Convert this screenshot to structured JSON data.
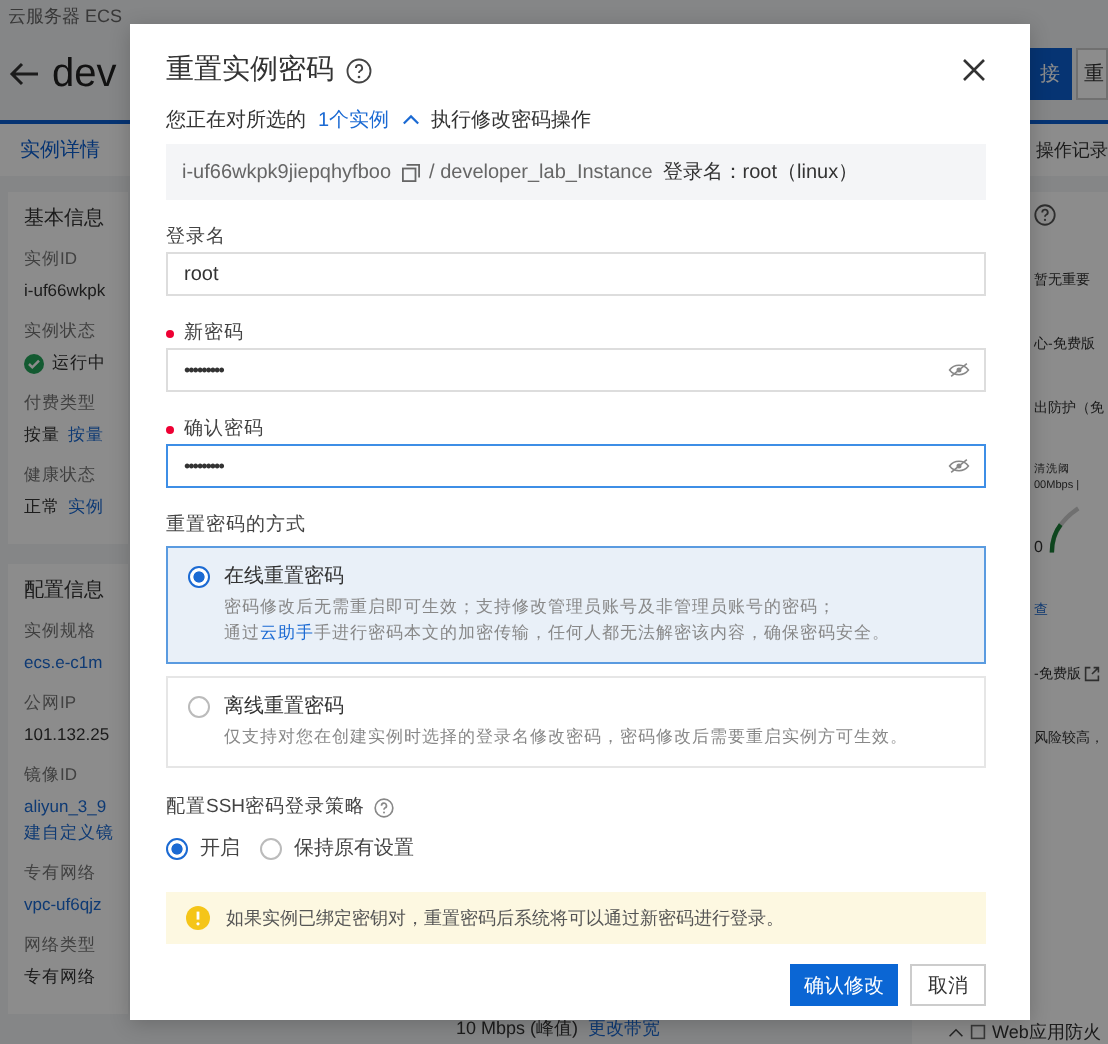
{
  "background": {
    "breadcrumb": "云服务器 ECS",
    "title": "dev",
    "header_buttons": [
      {
        "label": "接",
        "kind": "primary"
      },
      {
        "label": "重",
        "kind": "default"
      }
    ],
    "tabs": [
      {
        "label": "实例详情",
        "selected": true
      },
      {
        "label": "操作记录",
        "selected": false
      }
    ],
    "left_sections": [
      {
        "heading": "基本信息",
        "fields": [
          {
            "label": "实例ID",
            "value": "i-uf66wkpk"
          },
          {
            "label": "实例状态",
            "value": "运行中",
            "kind": "status"
          },
          {
            "label": "付费类型",
            "value": "按量",
            "links": [
              "按量"
            ]
          },
          {
            "label": "健康状态",
            "value": "正常",
            "links": [
              "实例"
            ]
          }
        ]
      },
      {
        "heading": "配置信息",
        "fields": [
          {
            "label": "实例规格",
            "links": [
              "ecs.e-c1m"
            ]
          },
          {
            "label": "公网IP",
            "value": "101.132.25"
          },
          {
            "label": "镜像ID",
            "links": [
              "aliyun_3_9",
              "建自定义镜"
            ]
          },
          {
            "label": "专有网络",
            "links": [
              "vpc-uf6qjz"
            ]
          },
          {
            "label": "网络类型",
            "value": "专有网络"
          }
        ]
      }
    ],
    "bandwidth": {
      "value": "10 Mbps (峰值)",
      "link": "更改带宽"
    },
    "right_panel": [
      {
        "kind": "help"
      },
      {
        "kind": "text",
        "text": "暂无重要"
      },
      {
        "kind": "text",
        "text": "心-免费版"
      },
      {
        "kind": "text",
        "text": "出防护（免"
      },
      {
        "kind": "gauge",
        "title": "清洗阈",
        "scale": "00Mbps |",
        "zero": "0"
      },
      {
        "kind": "link",
        "text": "查"
      },
      {
        "kind": "external",
        "text": "-免费版"
      },
      {
        "kind": "text",
        "text": "风险较高，"
      },
      {
        "kind": "footer",
        "text": "Web应用防火"
      }
    ]
  },
  "dialog": {
    "title": "重置实例密码",
    "intro": {
      "before": "您正在对所选的",
      "link": "1个实例",
      "after": "执行修改密码操作",
      "expanded": true
    },
    "instance": {
      "id": "i-uf66wkpk9jiepqhyfboo",
      "name": "/ developer_lab_Instance",
      "login": "登录名：root（linux）"
    },
    "fields": [
      {
        "label": "登录名",
        "value": "root",
        "required": false,
        "kind": "text",
        "focused": false
      },
      {
        "label": "新密码",
        "value": "•••••••••",
        "required": true,
        "kind": "password",
        "focused": false
      },
      {
        "label": "确认密码",
        "value": "•••••••••",
        "required": true,
        "kind": "password",
        "focused": true
      }
    ],
    "method_label": "重置密码的方式",
    "methods": [
      {
        "title": "在线重置密码",
        "selected": true,
        "lines": [
          {
            "text": "密码修改后无需重启即可生效；支持修改管理员账号及非管理员账号的密码；"
          },
          {
            "before": "通过",
            "link": "云助手",
            "after": "手进行密码本文的加密传输，任何人都无法解密该内容，确保密码安全。"
          }
        ]
      },
      {
        "title": "离线重置密码",
        "selected": false,
        "lines": [
          {
            "text": "仅支持对您在创建实例时选择的登录名修改密码，密码修改后需要重启实例方可生效。"
          }
        ]
      }
    ],
    "ssh_label": "配置SSH密码登录策略",
    "ssh_options": [
      {
        "label": "开启",
        "selected": true
      },
      {
        "label": "保持原有设置",
        "selected": false
      }
    ],
    "warning": "如果实例已绑定密钥对，重置密码后系统将可以通过新密码进行登录。",
    "buttons": [
      {
        "label": "确认修改",
        "kind": "primary"
      },
      {
        "label": "取消",
        "kind": "default"
      }
    ]
  }
}
